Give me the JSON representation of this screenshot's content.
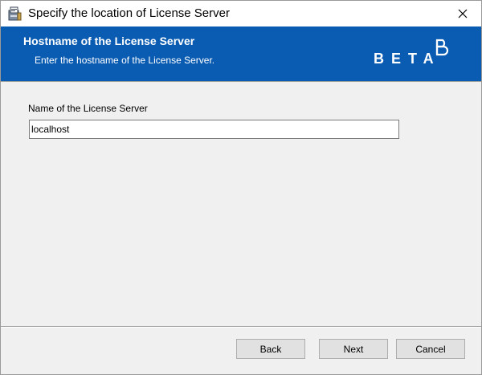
{
  "window": {
    "title": "Specify the location of License Server",
    "app_icon": "installer-package-icon",
    "close_icon": "close-icon"
  },
  "banner": {
    "heading": "Hostname of the License Server",
    "subheading": "Enter the hostname of the License Server.",
    "logo_text": "BETA",
    "logo_icon": "beta-logo-mark-icon",
    "background_color": "#0a5cb3"
  },
  "form": {
    "label": "Name of the License Server",
    "server_name_value": "localhost"
  },
  "buttons": {
    "back_label": "Back",
    "next_label": "Next",
    "cancel_label": "Cancel"
  }
}
